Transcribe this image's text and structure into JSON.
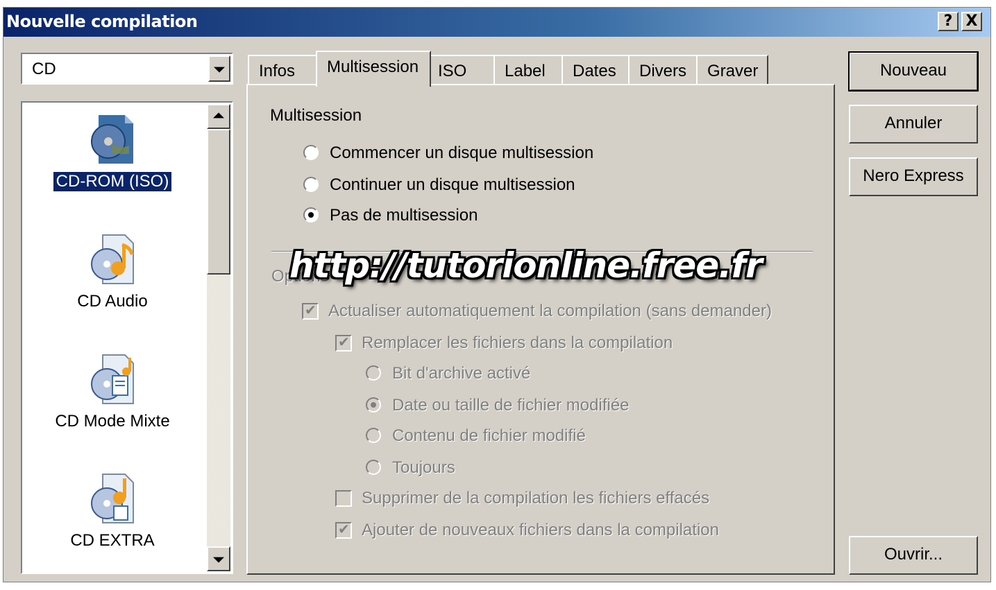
{
  "window": {
    "title": "Nouvelle compilation",
    "help_label": "?",
    "close_label": "X"
  },
  "media_combo": {
    "value": "CD"
  },
  "compilation_types": [
    {
      "label": "CD-ROM (ISO)",
      "icon": "cd-rom-iso-icon",
      "selected": true
    },
    {
      "label": "CD Audio",
      "icon": "cd-audio-icon",
      "selected": false
    },
    {
      "label": "CD Mode Mixte",
      "icon": "cd-mixed-mode-icon",
      "selected": false
    },
    {
      "label": "CD EXTRA",
      "icon": "cd-extra-icon",
      "selected": false
    }
  ],
  "tabs": [
    "Infos",
    "Multisession",
    "ISO",
    "Label",
    "Dates",
    "Divers",
    "Graver"
  ],
  "active_tab": "Multisession",
  "multisession": {
    "heading": "Multisession",
    "options": [
      {
        "label": "Commencer un disque multisession",
        "selected": false
      },
      {
        "label": "Continuer un disque multisession",
        "selected": false
      },
      {
        "label": "Pas de multisession",
        "selected": true
      }
    ]
  },
  "options_group": {
    "label": "Options",
    "auto_update": {
      "label": "Actualiser automatiquement la compilation (sans demander)",
      "checked": true,
      "enabled": false
    },
    "replace_files": {
      "label": "Remplacer les fichiers dans la compilation",
      "checked": true,
      "enabled": false
    },
    "replace_modes": [
      {
        "label": "Bit d'archive activé",
        "selected": false
      },
      {
        "label": "Date ou taille de fichier modifiée",
        "selected": true
      },
      {
        "label": "Contenu de fichier modifié",
        "selected": false
      },
      {
        "label": "Toujours",
        "selected": false
      }
    ],
    "delete_files": {
      "label": "Supprimer de la compilation les fichiers effacés",
      "checked": false,
      "enabled": false
    },
    "add_files": {
      "label": "Ajouter de nouveaux fichiers dans la compilation",
      "checked": true,
      "enabled": false
    }
  },
  "watermark": "http://tutorionline.free.fr",
  "buttons": {
    "new": "Nouveau",
    "cancel": "Annuler",
    "nero_express": "Nero Express",
    "open": "Ouvrir..."
  },
  "colors": {
    "title_bar": "#0a246a",
    "face": "#d4d0c8",
    "selection": "#0a246a"
  }
}
